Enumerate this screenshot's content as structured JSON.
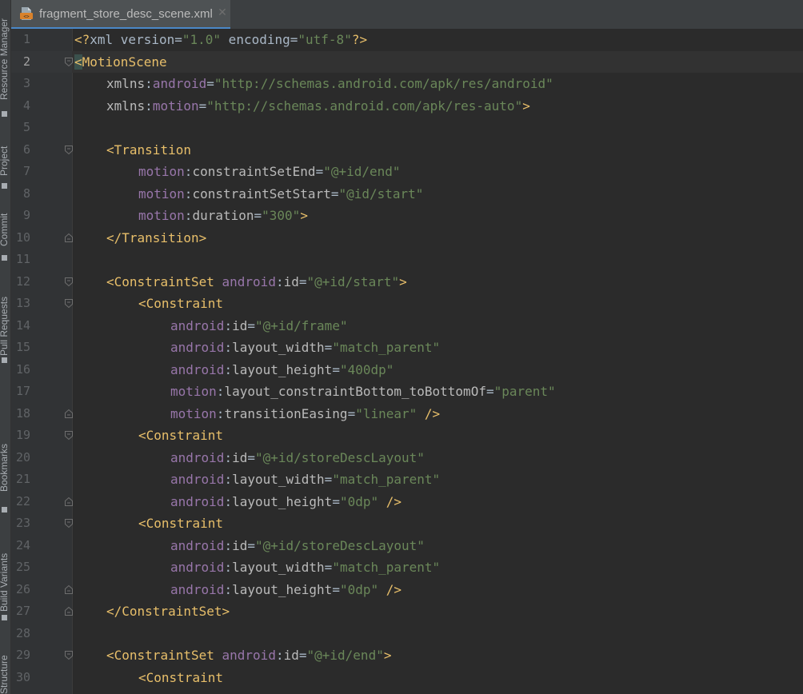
{
  "tool_strip": [
    {
      "label": "Resource Manager",
      "icon": "resource-manager-icon",
      "top": 0
    },
    {
      "label": "Project",
      "icon": "project-icon",
      "top": 0
    },
    {
      "label": "Commit",
      "icon": "commit-icon",
      "top": 0
    },
    {
      "label": "Pull Requests",
      "icon": "pull-requests-icon",
      "top": 0
    },
    {
      "label": "Bookmarks",
      "icon": "bookmarks-icon",
      "top": 0
    },
    {
      "label": "Build Variants",
      "icon": "build-variants-icon",
      "top": 0
    },
    {
      "label": "Structure",
      "icon": "structure-icon",
      "top": 0
    }
  ],
  "tab": {
    "title": "fragment_store_desc_scene.xml",
    "close": "✕",
    "file_icon": "xml-file-icon"
  },
  "editor": {
    "current_line": 2,
    "lines": [
      {
        "n": "1",
        "fold": "",
        "indent": 0,
        "tokens": [
          [
            "t-punct",
            "<?"
          ],
          [
            "t-plain",
            "xml version"
          ],
          [
            "t-eq",
            "="
          ],
          [
            "t-str",
            "\"1.0\""
          ],
          [
            "t-plain",
            " encoding"
          ],
          [
            "t-eq",
            "="
          ],
          [
            "t-str",
            "\"utf-8\""
          ],
          [
            "t-punct",
            "?>"
          ]
        ]
      },
      {
        "n": "2",
        "fold": "open",
        "indent": 0,
        "tokens": [
          [
            "t-punct t-hl",
            "<"
          ],
          [
            "t-tag",
            "MotionScene"
          ]
        ]
      },
      {
        "n": "3",
        "fold": "",
        "indent": 1,
        "tokens": [
          [
            "t-attr",
            "xmlns"
          ],
          [
            "t-plain",
            ":"
          ],
          [
            "t-ns",
            "android"
          ],
          [
            "t-eq",
            "="
          ],
          [
            "t-str",
            "\"http://schemas.android.com/apk/res/android\""
          ]
        ]
      },
      {
        "n": "4",
        "fold": "",
        "indent": 1,
        "tokens": [
          [
            "t-attr",
            "xmlns"
          ],
          [
            "t-plain",
            ":"
          ],
          [
            "t-ns",
            "motion"
          ],
          [
            "t-eq",
            "="
          ],
          [
            "t-str",
            "\"http://schemas.android.com/apk/res-auto\""
          ],
          [
            "t-punct",
            ">"
          ]
        ]
      },
      {
        "n": "5",
        "fold": "",
        "indent": 0,
        "tokens": []
      },
      {
        "n": "6",
        "fold": "open",
        "indent": 1,
        "tokens": [
          [
            "t-punct",
            "<"
          ],
          [
            "t-tag",
            "Transition"
          ]
        ]
      },
      {
        "n": "7",
        "fold": "",
        "indent": 2,
        "tokens": [
          [
            "t-ns",
            "motion"
          ],
          [
            "t-plain",
            ":"
          ],
          [
            "t-attr",
            "constraintSetEnd"
          ],
          [
            "t-eq",
            "="
          ],
          [
            "t-str",
            "\"@+id/end\""
          ]
        ]
      },
      {
        "n": "8",
        "fold": "",
        "indent": 2,
        "tokens": [
          [
            "t-ns",
            "motion"
          ],
          [
            "t-plain",
            ":"
          ],
          [
            "t-attr",
            "constraintSetStart"
          ],
          [
            "t-eq",
            "="
          ],
          [
            "t-str",
            "\"@id/start\""
          ]
        ]
      },
      {
        "n": "9",
        "fold": "",
        "indent": 2,
        "tokens": [
          [
            "t-ns",
            "motion"
          ],
          [
            "t-plain",
            ":"
          ],
          [
            "t-attr",
            "duration"
          ],
          [
            "t-eq",
            "="
          ],
          [
            "t-str",
            "\"300\""
          ],
          [
            "t-punct",
            ">"
          ]
        ]
      },
      {
        "n": "10",
        "fold": "close",
        "indent": 1,
        "tokens": [
          [
            "t-punct",
            "</"
          ],
          [
            "t-tag",
            "Transition"
          ],
          [
            "t-punct",
            ">"
          ]
        ]
      },
      {
        "n": "11",
        "fold": "",
        "indent": 0,
        "tokens": []
      },
      {
        "n": "12",
        "fold": "open",
        "indent": 1,
        "tokens": [
          [
            "t-punct",
            "<"
          ],
          [
            "t-tag",
            "ConstraintSet"
          ],
          [
            "t-plain",
            " "
          ],
          [
            "t-ns",
            "android"
          ],
          [
            "t-plain",
            ":"
          ],
          [
            "t-attr",
            "id"
          ],
          [
            "t-eq",
            "="
          ],
          [
            "t-str",
            "\"@+id/start\""
          ],
          [
            "t-punct",
            ">"
          ]
        ]
      },
      {
        "n": "13",
        "fold": "open",
        "indent": 2,
        "tokens": [
          [
            "t-punct",
            "<"
          ],
          [
            "t-tag",
            "Constraint"
          ]
        ]
      },
      {
        "n": "14",
        "fold": "",
        "indent": 3,
        "tokens": [
          [
            "t-ns",
            "android"
          ],
          [
            "t-plain",
            ":"
          ],
          [
            "t-attr",
            "id"
          ],
          [
            "t-eq",
            "="
          ],
          [
            "t-str",
            "\"@+id/frame\""
          ]
        ]
      },
      {
        "n": "15",
        "fold": "",
        "indent": 3,
        "tokens": [
          [
            "t-ns",
            "android"
          ],
          [
            "t-plain",
            ":"
          ],
          [
            "t-attr",
            "layout_width"
          ],
          [
            "t-eq",
            "="
          ],
          [
            "t-str",
            "\"match_parent\""
          ]
        ]
      },
      {
        "n": "16",
        "fold": "",
        "indent": 3,
        "tokens": [
          [
            "t-ns",
            "android"
          ],
          [
            "t-plain",
            ":"
          ],
          [
            "t-attr",
            "layout_height"
          ],
          [
            "t-eq",
            "="
          ],
          [
            "t-str",
            "\"400dp\""
          ]
        ]
      },
      {
        "n": "17",
        "fold": "",
        "indent": 3,
        "tokens": [
          [
            "t-ns",
            "motion"
          ],
          [
            "t-plain",
            ":"
          ],
          [
            "t-attr",
            "layout_constraintBottom_toBottomOf"
          ],
          [
            "t-eq",
            "="
          ],
          [
            "t-str",
            "\"parent\""
          ]
        ]
      },
      {
        "n": "18",
        "fold": "close",
        "indent": 3,
        "tokens": [
          [
            "t-ns",
            "motion"
          ],
          [
            "t-plain",
            ":"
          ],
          [
            "t-attr",
            "transitionEasing"
          ],
          [
            "t-eq",
            "="
          ],
          [
            "t-str",
            "\"linear\""
          ],
          [
            "t-plain",
            " "
          ],
          [
            "t-punct",
            "/>"
          ]
        ]
      },
      {
        "n": "19",
        "fold": "open",
        "indent": 2,
        "tokens": [
          [
            "t-punct",
            "<"
          ],
          [
            "t-tag",
            "Constraint"
          ]
        ]
      },
      {
        "n": "20",
        "fold": "",
        "indent": 3,
        "tokens": [
          [
            "t-ns",
            "android"
          ],
          [
            "t-plain",
            ":"
          ],
          [
            "t-attr",
            "id"
          ],
          [
            "t-eq",
            "="
          ],
          [
            "t-str",
            "\"@+id/storeDescLayout\""
          ]
        ]
      },
      {
        "n": "21",
        "fold": "",
        "indent": 3,
        "tokens": [
          [
            "t-ns",
            "android"
          ],
          [
            "t-plain",
            ":"
          ],
          [
            "t-attr",
            "layout_width"
          ],
          [
            "t-eq",
            "="
          ],
          [
            "t-str",
            "\"match_parent\""
          ]
        ]
      },
      {
        "n": "22",
        "fold": "close",
        "indent": 3,
        "tokens": [
          [
            "t-ns",
            "android"
          ],
          [
            "t-plain",
            ":"
          ],
          [
            "t-attr",
            "layout_height"
          ],
          [
            "t-eq",
            "="
          ],
          [
            "t-str",
            "\"0dp\""
          ],
          [
            "t-plain",
            " "
          ],
          [
            "t-punct",
            "/>"
          ]
        ]
      },
      {
        "n": "23",
        "fold": "open",
        "indent": 2,
        "tokens": [
          [
            "t-punct",
            "<"
          ],
          [
            "t-tag",
            "Constraint"
          ]
        ]
      },
      {
        "n": "24",
        "fold": "",
        "indent": 3,
        "tokens": [
          [
            "t-ns",
            "android"
          ],
          [
            "t-plain",
            ":"
          ],
          [
            "t-attr",
            "id"
          ],
          [
            "t-eq",
            "="
          ],
          [
            "t-str",
            "\"@+id/storeDescLayout\""
          ]
        ]
      },
      {
        "n": "25",
        "fold": "",
        "indent": 3,
        "tokens": [
          [
            "t-ns",
            "android"
          ],
          [
            "t-plain",
            ":"
          ],
          [
            "t-attr",
            "layout_width"
          ],
          [
            "t-eq",
            "="
          ],
          [
            "t-str",
            "\"match_parent\""
          ]
        ]
      },
      {
        "n": "26",
        "fold": "close",
        "indent": 3,
        "tokens": [
          [
            "t-ns",
            "android"
          ],
          [
            "t-plain",
            ":"
          ],
          [
            "t-attr",
            "layout_height"
          ],
          [
            "t-eq",
            "="
          ],
          [
            "t-str",
            "\"0dp\""
          ],
          [
            "t-plain",
            " "
          ],
          [
            "t-punct",
            "/>"
          ]
        ]
      },
      {
        "n": "27",
        "fold": "close",
        "indent": 1,
        "tokens": [
          [
            "t-punct",
            "</"
          ],
          [
            "t-tag",
            "ConstraintSet"
          ],
          [
            "t-punct",
            ">"
          ]
        ]
      },
      {
        "n": "28",
        "fold": "",
        "indent": 0,
        "tokens": []
      },
      {
        "n": "29",
        "fold": "open",
        "indent": 1,
        "tokens": [
          [
            "t-punct",
            "<"
          ],
          [
            "t-tag",
            "ConstraintSet"
          ],
          [
            "t-plain",
            " "
          ],
          [
            "t-ns",
            "android"
          ],
          [
            "t-plain",
            ":"
          ],
          [
            "t-attr",
            "id"
          ],
          [
            "t-eq",
            "="
          ],
          [
            "t-str",
            "\"@+id/end\""
          ],
          [
            "t-punct",
            ">"
          ]
        ]
      },
      {
        "n": "30",
        "fold": "",
        "indent": 2,
        "tokens": [
          [
            "t-punct",
            "<"
          ],
          [
            "t-tag",
            "Constraint"
          ]
        ]
      }
    ]
  }
}
